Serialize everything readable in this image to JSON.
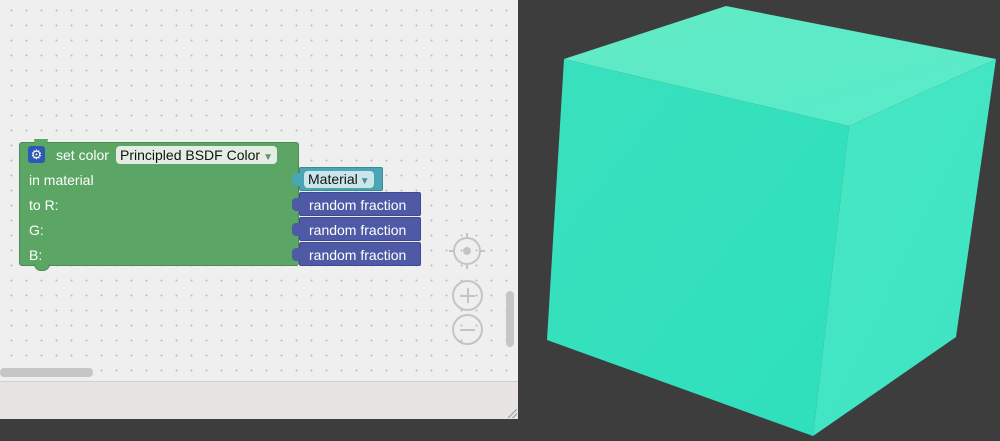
{
  "block": {
    "label": "set color",
    "property_dropdown": "Principled BSDF Color",
    "row_material": "in material",
    "row_r": "to R:",
    "row_g": "G:",
    "row_b": "B:"
  },
  "material_input": {
    "value": "Material"
  },
  "random_blocks": [
    {
      "label": "random fraction"
    },
    {
      "label": "random fraction"
    },
    {
      "label": "random fraction"
    }
  ],
  "icons": {
    "block_settings": "gear-icon",
    "dropdown_arrow": "triangle-down-icon",
    "recenter": "target-icon",
    "zoom_in": "plus-circle-icon",
    "zoom_out": "minus-circle-icon"
  },
  "colors": {
    "block_green": "#5ba565",
    "material_teal": "#4aa6b5",
    "random_blue": "#4f5aa6",
    "cube_top": "#5fecc6",
    "cube_left": "#36e0bd",
    "cube_right": "#48e8c8",
    "viewport_bg": "#3d3d3d"
  }
}
